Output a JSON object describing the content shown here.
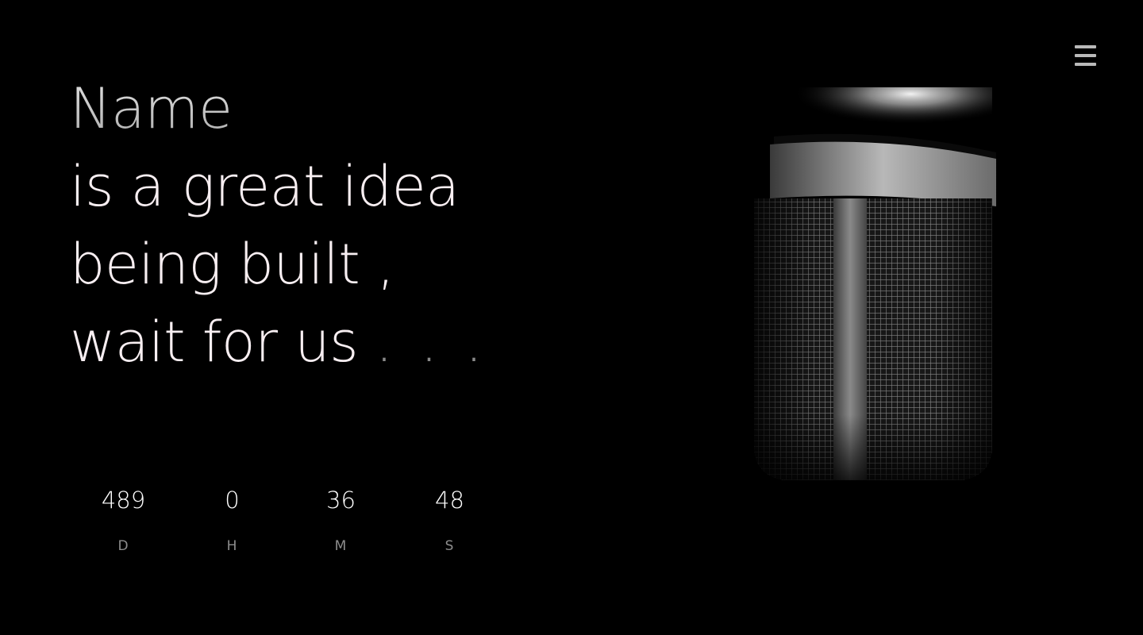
{
  "nav": {
    "menu_icon": "hamburger-menu-icon"
  },
  "hero": {
    "name": "Name",
    "line1": "is a great idea",
    "line2": "being built ,",
    "line3": "wait for us",
    "ellipsis": ". . ."
  },
  "countdown": {
    "days": {
      "value": "489",
      "label": "D"
    },
    "hours": {
      "value": "0",
      "label": "H"
    },
    "minutes": {
      "value": "36",
      "label": "M"
    },
    "seconds": {
      "value": "48",
      "label": "S"
    }
  },
  "image": {
    "subject": "microphone",
    "icon": "microphone-icon"
  },
  "colors": {
    "background": "#000000",
    "headline": "#f7eef1",
    "muted": "#8d8d8d",
    "menu": "#b9b9b9"
  }
}
